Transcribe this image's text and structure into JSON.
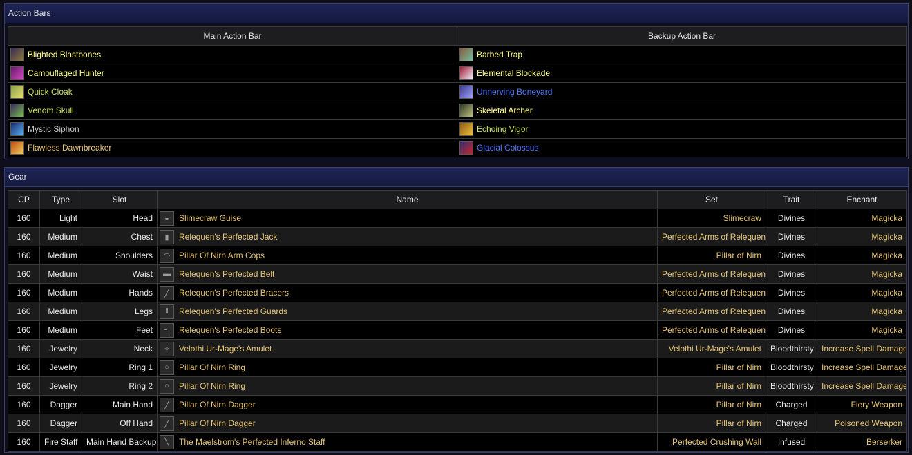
{
  "action_bars": {
    "title": "Action Bars",
    "main_header": "Main Action Bar",
    "backup_header": "Backup Action Bar",
    "main": [
      {
        "name": "Blighted Blastbones",
        "icon": "bone-skull-icon",
        "color": "#ffff88"
      },
      {
        "name": "Camouflaged Hunter",
        "icon": "hunter-icon",
        "color": "#ffff88"
      },
      {
        "name": "Quick Cloak",
        "icon": "cloak-icon",
        "color": "#c8e060"
      },
      {
        "name": "Venom Skull",
        "icon": "venom-skull-icon",
        "color": "#c8e060"
      },
      {
        "name": "Mystic Siphon",
        "icon": "siphon-icon",
        "color": "#c8c8c8"
      },
      {
        "name": "Flawless Dawnbreaker",
        "icon": "dawnbreaker-icon",
        "color": "#e6c572"
      }
    ],
    "backup": [
      {
        "name": "Barbed Trap",
        "icon": "trap-icon",
        "color": "#ffff88"
      },
      {
        "name": "Elemental Blockade",
        "icon": "blockade-icon",
        "color": "#ffff88"
      },
      {
        "name": "Unnerving Boneyard",
        "icon": "boneyard-icon",
        "color": "#4f78ff"
      },
      {
        "name": "Skeletal Archer",
        "icon": "archer-icon",
        "color": "#ffff88"
      },
      {
        "name": "Echoing Vigor",
        "icon": "vigor-icon",
        "color": "#c8e060"
      },
      {
        "name": "Glacial Colossus",
        "icon": "colossus-icon",
        "color": "#4f78ff"
      }
    ]
  },
  "gear": {
    "title": "Gear",
    "headers": {
      "cp": "CP",
      "type": "Type",
      "slot": "Slot",
      "name": "Name",
      "set": "Set",
      "trait": "Trait",
      "enchant": "Enchant"
    },
    "rows": [
      {
        "cp": "160",
        "type": "Light",
        "slot": "Head",
        "name": "Slimecraw Guise",
        "set": "Slimecraw",
        "trait": "Divines",
        "enchant": "Magicka",
        "icon": "helmet-icon"
      },
      {
        "cp": "160",
        "type": "Medium",
        "slot": "Chest",
        "name": "Relequen's Perfected Jack",
        "set": "Perfected Arms of Relequen",
        "trait": "Divines",
        "enchant": "Magicka",
        "icon": "chest-armor-icon"
      },
      {
        "cp": "160",
        "type": "Medium",
        "slot": "Shoulders",
        "name": "Pillar Of Nirn Arm Cops",
        "set": "Pillar of Nirn",
        "trait": "Divines",
        "enchant": "Magicka",
        "icon": "shoulder-armor-icon"
      },
      {
        "cp": "160",
        "type": "Medium",
        "slot": "Waist",
        "name": "Relequen's Perfected Belt",
        "set": "Perfected Arms of Relequen",
        "trait": "Divines",
        "enchant": "Magicka",
        "icon": "belt-icon"
      },
      {
        "cp": "160",
        "type": "Medium",
        "slot": "Hands",
        "name": "Relequen's Perfected Bracers",
        "set": "Perfected Arms of Relequen",
        "trait": "Divines",
        "enchant": "Magicka",
        "icon": "bracers-icon"
      },
      {
        "cp": "160",
        "type": "Medium",
        "slot": "Legs",
        "name": "Relequen's Perfected Guards",
        "set": "Perfected Arms of Relequen",
        "trait": "Divines",
        "enchant": "Magicka",
        "icon": "legs-armor-icon"
      },
      {
        "cp": "160",
        "type": "Medium",
        "slot": "Feet",
        "name": "Relequen's Perfected Boots",
        "set": "Perfected Arms of Relequen",
        "trait": "Divines",
        "enchant": "Magicka",
        "icon": "boots-icon"
      },
      {
        "cp": "160",
        "type": "Jewelry",
        "slot": "Neck",
        "name": "Velothi Ur-Mage's Amulet",
        "set": "Velothi Ur-Mage's Amulet",
        "trait": "Bloodthirsty",
        "enchant": "Increase Spell Damage",
        "icon": "amulet-icon"
      },
      {
        "cp": "160",
        "type": "Jewelry",
        "slot": "Ring 1",
        "name": "Pillar Of Nirn Ring",
        "set": "Pillar of Nirn",
        "trait": "Bloodthirsty",
        "enchant": "Increase Spell Damage",
        "icon": "ring-icon"
      },
      {
        "cp": "160",
        "type": "Jewelry",
        "slot": "Ring 2",
        "name": "Pillar Of Nirn Ring",
        "set": "Pillar of Nirn",
        "trait": "Bloodthirsty",
        "enchant": "Increase Spell Damage",
        "icon": "ring-icon"
      },
      {
        "cp": "160",
        "type": "Dagger",
        "slot": "Main Hand",
        "name": "Pillar Of Nirn Dagger",
        "set": "Pillar of Nirn",
        "trait": "Charged",
        "enchant": "Fiery Weapon",
        "icon": "dagger-icon"
      },
      {
        "cp": "160",
        "type": "Dagger",
        "slot": "Off Hand",
        "name": "Pillar Of Nirn Dagger",
        "set": "Pillar of Nirn",
        "trait": "Charged",
        "enchant": "Poisoned Weapon",
        "icon": "dagger-icon"
      },
      {
        "cp": "160",
        "type": "Fire Staff",
        "slot": "Main Hand Backup",
        "name": "The Maelstrom's Perfected Inferno Staff",
        "set": "Perfected Crushing Wall",
        "trait": "Infused",
        "enchant": "Berserker",
        "icon": "staff-icon"
      }
    ]
  },
  "colors": {
    "panel_border": "#39406e",
    "header_bg": "#1e2455",
    "gold": "#e6c572",
    "link_blue": "#4f78ff"
  }
}
